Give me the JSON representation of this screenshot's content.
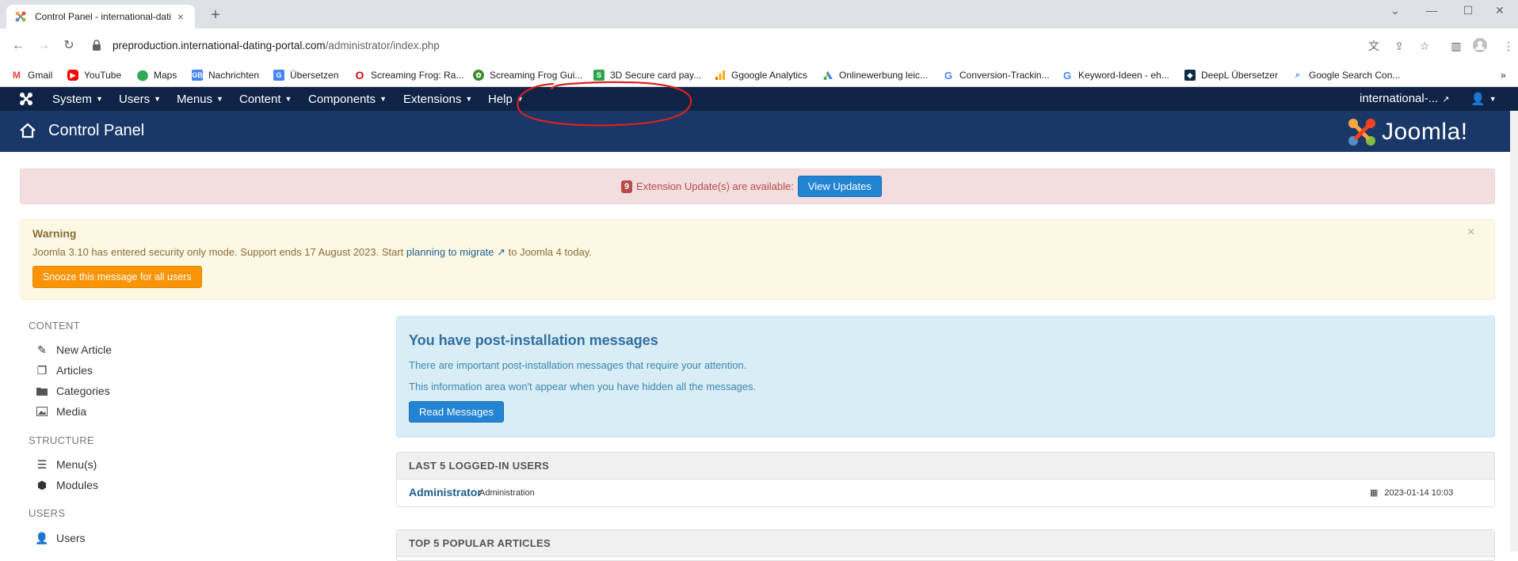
{
  "browser": {
    "tab_title": "Control Panel - international-dati",
    "tab_close": "×",
    "new_tab": "+",
    "url_host": "preproduction.international-dating-portal.com",
    "url_path": "/administrator/index.php",
    "bookmarks": [
      {
        "label": "Gmail",
        "icon": "gmail-icon",
        "color": "#ea4335"
      },
      {
        "label": "YouTube",
        "icon": "youtube-icon",
        "color": "#ff0000"
      },
      {
        "label": "Maps",
        "icon": "maps-icon",
        "color": "#34a853"
      },
      {
        "label": "Nachrichten",
        "icon": "news-icon",
        "color": "#4285f4"
      },
      {
        "label": "Übersetzen",
        "icon": "translate-icon",
        "color": "#4285f4"
      },
      {
        "label": "Screaming Frog: Ra...",
        "icon": "opera-icon",
        "color": "#cc0f16"
      },
      {
        "label": "Screaming Frog Gui...",
        "icon": "frog-icon",
        "color": "#3c8a2e"
      },
      {
        "label": "3D Secure card pay...",
        "icon": "s-icon",
        "color": "#2da44e"
      },
      {
        "label": "Ggoogle Analytics",
        "icon": "analytics-icon",
        "color": "#f9ab00"
      },
      {
        "label": "Onlinewerbung leic...",
        "icon": "ads-icon",
        "color": "#4285f4"
      },
      {
        "label": "Conversion-Trackin...",
        "icon": "google-icon",
        "color": "#4285f4"
      },
      {
        "label": "Keyword-Ideen - eh...",
        "icon": "google-icon",
        "color": "#4285f4"
      },
      {
        "label": "DeepL Übersetzer",
        "icon": "deepl-icon",
        "color": "#0f2b46"
      },
      {
        "label": "Google Search Con...",
        "icon": "search-console-icon",
        "color": "#4285f4"
      }
    ],
    "more_bookmarks": "»"
  },
  "admin_nav": {
    "menus": [
      "System",
      "Users",
      "Menus",
      "Content",
      "Components",
      "Extensions",
      "Help"
    ],
    "site_link": "international-..."
  },
  "header": {
    "title": "Control Panel",
    "brand": "Joomla!",
    "brand_colors": [
      "#f9a541",
      "#f44321",
      "#5091cd",
      "#7ac143"
    ]
  },
  "update_alert": {
    "count": "9",
    "message": "Extension Update(s) are available:",
    "button": "View Updates"
  },
  "warning": {
    "title": "Warning",
    "text_before": "Joomla 3.10 has entered security only mode. Support ends 17 August 2023. Start",
    "link": "planning to migrate",
    "text_after": "to Joomla 4 today.",
    "close": "×",
    "snooze_button": "Snooze this message for all users"
  },
  "sidebar": {
    "content_heading": "CONTENT",
    "content_items": [
      "New Article",
      "Articles",
      "Categories",
      "Media"
    ],
    "structure_heading": "STRUCTURE",
    "structure_items": [
      "Menu(s)",
      "Modules"
    ],
    "users_heading": "USERS",
    "users_items": [
      "Users"
    ]
  },
  "post_install": {
    "title": "You have post-installation messages",
    "line1": "There are important post-installation messages that require your attention.",
    "line2": "This information area won't appear when you have hidden all the messages.",
    "button": "Read Messages"
  },
  "logged_in": {
    "heading": "LAST 5 LOGGED-IN USERS",
    "rows": [
      {
        "name": "Administrator",
        "role": "Administration",
        "date": "2023-01-14 10:03"
      }
    ]
  },
  "popular": {
    "heading": "TOP 5 POPULAR ARTICLES"
  },
  "colors": {
    "nav_bg": "#0f2347",
    "header_bg": "#1a3867",
    "annotation": "#d9221f"
  }
}
